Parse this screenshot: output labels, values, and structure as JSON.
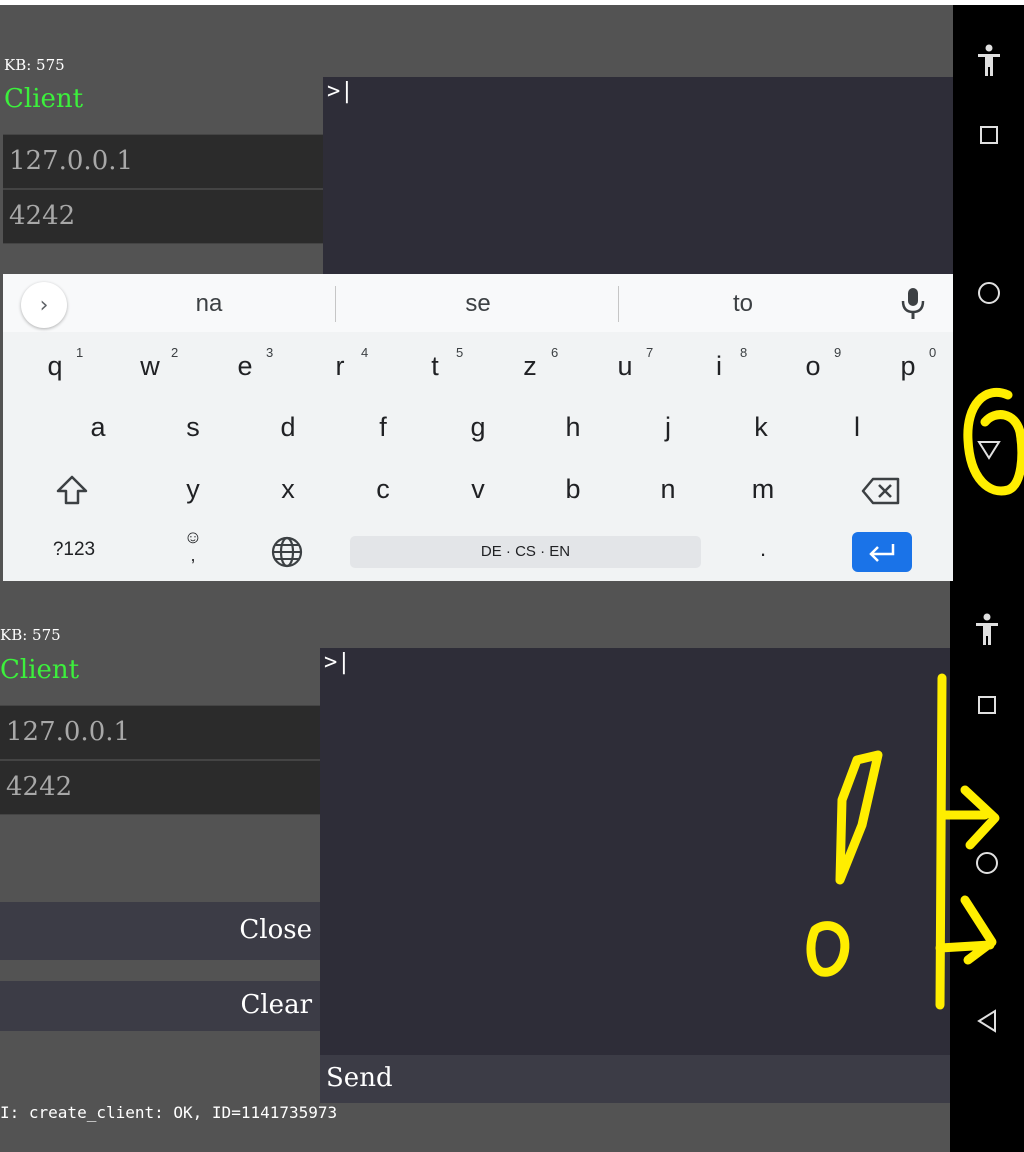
{
  "top": {
    "kb_label": "KB: 575",
    "client_label": "Client",
    "host_value": "127.0.0.1",
    "port_value": "4242",
    "console_prompt": ">|"
  },
  "keyboard": {
    "suggestions": [
      "na",
      "se",
      "to"
    ],
    "row1": [
      {
        "key": "q",
        "num": "1"
      },
      {
        "key": "w",
        "num": "2"
      },
      {
        "key": "e",
        "num": "3"
      },
      {
        "key": "r",
        "num": "4"
      },
      {
        "key": "t",
        "num": "5"
      },
      {
        "key": "z",
        "num": "6"
      },
      {
        "key": "u",
        "num": "7"
      },
      {
        "key": "i",
        "num": "8"
      },
      {
        "key": "o",
        "num": "9"
      },
      {
        "key": "p",
        "num": "0"
      }
    ],
    "row2": [
      "a",
      "s",
      "d",
      "f",
      "g",
      "h",
      "j",
      "k",
      "l"
    ],
    "row3": [
      "y",
      "x",
      "c",
      "v",
      "b",
      "n",
      "m"
    ],
    "symbols_key": "?123",
    "emoji_key": "☺",
    "emoji_sub": ",",
    "space_label": "DE · CS · EN",
    "period_key": "."
  },
  "bottom": {
    "kb_label": "KB: 575",
    "client_label": "Client",
    "host_value": "127.0.0.1",
    "port_value": "4242",
    "console_prompt": ">|",
    "close_label": "Close",
    "clear_label": "Clear",
    "send_label": "Send",
    "status_text": "I: create_client: OK, ID=1141735973"
  },
  "colors": {
    "app_bg": "#535353",
    "console_bg": "#2e2d38",
    "client_green": "#3cf03c",
    "enter_blue": "#1a73e8",
    "annotation_yellow": "#ffee00"
  },
  "icons": {
    "nav": [
      "accessibility-icon",
      "recents-square-icon",
      "home-circle-icon",
      "back-icon"
    ],
    "keyboard": [
      "chevron-right-icon",
      "microphone-icon",
      "shift-icon",
      "backspace-icon",
      "globe-icon",
      "enter-icon"
    ]
  }
}
